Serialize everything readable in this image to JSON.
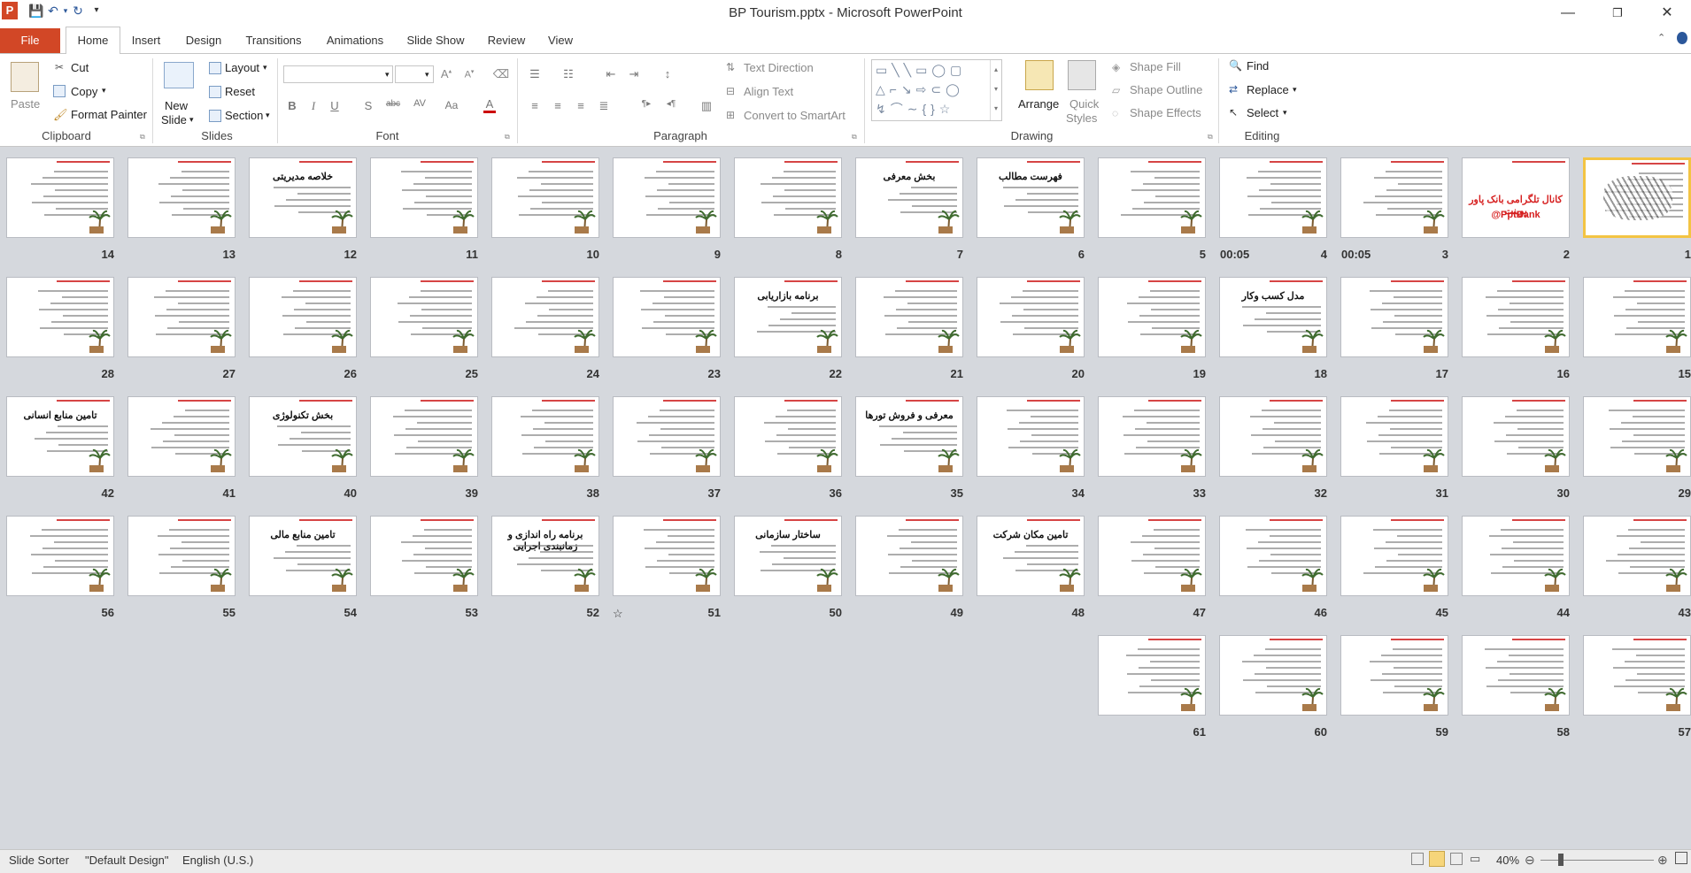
{
  "window": {
    "title": "BP Tourism.pptx - Microsoft PowerPoint",
    "app_icon_letter": "P",
    "controls": {
      "minimize": "—",
      "restore": "❐",
      "close": "✕"
    }
  },
  "quick_access": {
    "save": "💾",
    "undo": "↶",
    "undo_drop": "▾",
    "redo": "↻",
    "customize": "▾"
  },
  "tabs": {
    "file": "File",
    "home": "Home",
    "insert": "Insert",
    "design": "Design",
    "transitions": "Transitions",
    "animations": "Animations",
    "slide_show": "Slide Show",
    "review": "Review",
    "view": "View"
  },
  "ribbon": {
    "clipboard": {
      "label": "Clipboard",
      "paste": "Paste",
      "cut": "Cut",
      "copy": "Copy",
      "format_painter": "Format Painter"
    },
    "slides": {
      "label": "Slides",
      "new_slide_1": "New",
      "new_slide_2": "Slide",
      "layout": "Layout",
      "reset": "Reset",
      "section": "Section"
    },
    "font": {
      "label": "Font"
    },
    "paragraph": {
      "label": "Paragraph",
      "text_direction": "Text Direction",
      "align_text": "Align Text",
      "convert_smartart": "Convert to SmartArt"
    },
    "drawing": {
      "label": "Drawing",
      "arrange": "Arrange",
      "quick_styles_1": "Quick",
      "quick_styles_2": "Styles",
      "shape_fill": "Shape Fill",
      "shape_outline": "Shape Outline",
      "shape_effects": "Shape Effects"
    },
    "editing": {
      "label": "Editing",
      "find": "Find",
      "replace": "Replace",
      "select": "Select"
    }
  },
  "slides": [
    {
      "n": "1",
      "title": ""
    },
    {
      "n": "2",
      "title": "کانال تلگرامی بانک پاور پوینت",
      "sub": "@PptBank"
    },
    {
      "n": "3"
    },
    {
      "n": "4"
    },
    {
      "n": "5"
    },
    {
      "n": "6",
      "title": "فهرست مطالب"
    },
    {
      "n": "7",
      "title": "بخش معرفی"
    },
    {
      "n": "8"
    },
    {
      "n": "9"
    },
    {
      "n": "10"
    },
    {
      "n": "11"
    },
    {
      "n": "12",
      "title": "خلاصه مدیریتی"
    },
    {
      "n": "13"
    },
    {
      "n": "14"
    },
    {
      "n": "15"
    },
    {
      "n": "16"
    },
    {
      "n": "17"
    },
    {
      "n": "18",
      "title": "مدل کسب وکار"
    },
    {
      "n": "19"
    },
    {
      "n": "20"
    },
    {
      "n": "21"
    },
    {
      "n": "22",
      "title": "برنامه بازاریابی"
    },
    {
      "n": "23"
    },
    {
      "n": "24"
    },
    {
      "n": "25"
    },
    {
      "n": "26"
    },
    {
      "n": "27"
    },
    {
      "n": "28"
    },
    {
      "n": "29"
    },
    {
      "n": "30"
    },
    {
      "n": "31"
    },
    {
      "n": "32"
    },
    {
      "n": "33"
    },
    {
      "n": "34"
    },
    {
      "n": "35",
      "title": "معرفی و فروش تورها"
    },
    {
      "n": "36"
    },
    {
      "n": "37"
    },
    {
      "n": "38"
    },
    {
      "n": "39"
    },
    {
      "n": "40",
      "title": "بخش تکنولوژی"
    },
    {
      "n": "41"
    },
    {
      "n": "42",
      "title": "تامین منابع انسانی"
    },
    {
      "n": "43"
    },
    {
      "n": "44"
    },
    {
      "n": "45"
    },
    {
      "n": "46"
    },
    {
      "n": "47"
    },
    {
      "n": "48",
      "title": "تامین مکان شرکت"
    },
    {
      "n": "49"
    },
    {
      "n": "50",
      "title": "ساختار سازمانی"
    },
    {
      "n": "51"
    },
    {
      "n": "52",
      "title": "برنامه راه اندازی و زمانبندی اجرایی"
    },
    {
      "n": "53"
    },
    {
      "n": "54",
      "title": "تامین منابع مالی"
    },
    {
      "n": "55"
    },
    {
      "n": "56"
    },
    {
      "n": "57"
    },
    {
      "n": "58"
    },
    {
      "n": "59"
    },
    {
      "n": "60"
    },
    {
      "n": "61"
    }
  ],
  "timings": {
    "slide3": "00:05",
    "slide4": "00:05"
  },
  "animation_marker": "☆",
  "status": {
    "view": "Slide Sorter",
    "theme": "\"Default Design\"",
    "language": "English (U.S.)",
    "zoom": "40%"
  }
}
